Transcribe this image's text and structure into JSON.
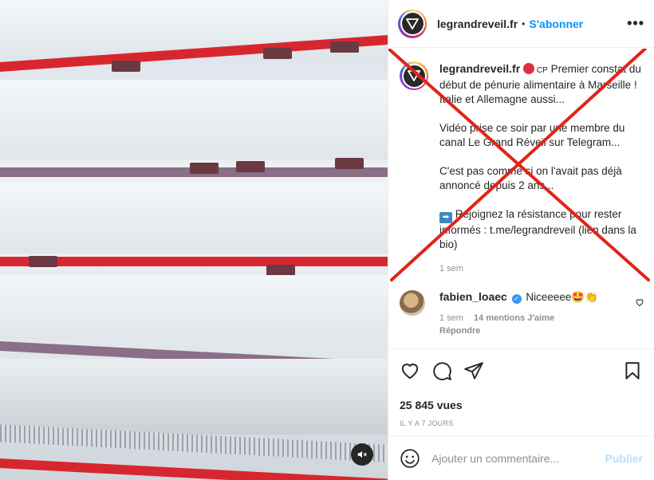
{
  "post": {
    "username": "legrandreveil.fr",
    "separator": "•",
    "follow_label": "S'abonner",
    "more_label": "•••"
  },
  "caption": {
    "username": "legrandreveil.fr",
    "cp": "CP",
    "line1": " Premier constat du début de pénurie alimentaire à Marseille ! Italie et Allemagne aussi...",
    "para2": "Vidéo prise ce soir par une membre du canal Le Grand Réveil sur Telegram...",
    "para3": "C'est pas comme si on l'avait pas déjà annoncé depuis 2 ans...",
    "arrow": "➡",
    "para4": " Rejoignez la résistance pour rester informés : t.me/legrandreveil (lien dans la bio)",
    "time": "1 sem"
  },
  "comment": {
    "username": "fabien_loaec",
    "text": "Niceeeee",
    "emojis": "🤩👏",
    "time": "1 sem",
    "likes": "14 mentions J'aime",
    "reply": "Répondre"
  },
  "stats": {
    "views": "25 845 vues",
    "ago": "IL Y A 7 JOURS"
  },
  "composer": {
    "placeholder": "Ajouter un commentaire...",
    "publish_label": "Publier"
  },
  "icons": [
    "mute-icon",
    "more-icon",
    "heart-icon",
    "comment-icon",
    "share-icon",
    "bookmark-icon",
    "emoji-icon",
    "small-heart-icon",
    "verified-icon"
  ],
  "colors": {
    "accent": "#0095f6",
    "cross": "#e2231a",
    "muted": "#8e8e8e"
  }
}
